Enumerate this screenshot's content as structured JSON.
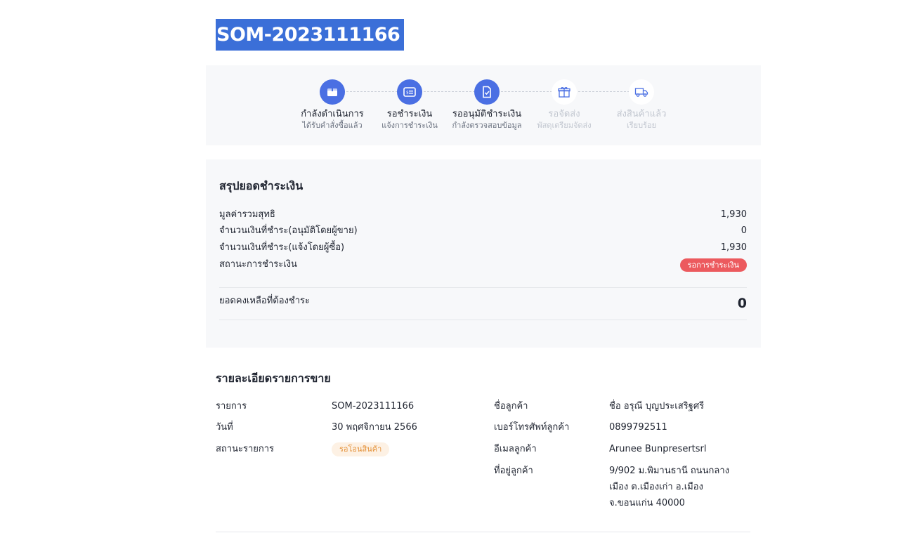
{
  "order": {
    "id": "SOM-2023111166"
  },
  "steps": [
    {
      "title": "กำลังดำเนินการ",
      "subtitle": "ได้รับคำสั่งซื้อแล้ว",
      "icon": "box-icon",
      "state": "done"
    },
    {
      "title": "รอชำระเงิน",
      "subtitle": "แจ้งการชำระเงิน",
      "icon": "payment-card-icon",
      "state": "done"
    },
    {
      "title": "รออนุมัติชำระเงิน",
      "subtitle": "กำลังตรวจสอบข้อมูล",
      "icon": "document-check-icon",
      "state": "current"
    },
    {
      "title": "รอจัดส่ง",
      "subtitle": "พัสดุเตรียมจัดส่ง",
      "icon": "gift-icon",
      "state": "pending"
    },
    {
      "title": "ส่งสินค้าแล้ว",
      "subtitle": "เรียบร้อย",
      "icon": "truck-icon",
      "state": "pending"
    }
  ],
  "summary": {
    "heading": "สรุปยอดชำระเงิน",
    "net_total_label": "มูลค่ารวมสุทธิ",
    "net_total_value": "1,930",
    "paid_approved_label": "จำนวนเงินที่ชำระ(อนุมัติโดยผู้ขาย)",
    "paid_approved_value": "0",
    "paid_reported_label": "จำนวนเงินที่ชำระ(แจ้งโดยผู้ซื้อ)",
    "paid_reported_value": "1,930",
    "payment_status_label": "สถานะการชำระเงิน",
    "payment_status_value": "รอการชำระเงิน",
    "balance_label": "ยอดคงเหลือที่ต้องชำระ",
    "balance_value": "0"
  },
  "details": {
    "heading": "รายละเอียดรายการขาย",
    "item_label": "รายการ",
    "item_value": "SOM-2023111166",
    "date_label": "วันที่",
    "date_value": "30 พฤศจิกายน 2566",
    "status_label": "สถานะรายการ",
    "status_value": "รอโอนสินค้า",
    "customer_name_label": "ชื่อลูกค้า",
    "customer_name_value": "ชื่อ อรุณี บุญประเสริฐศรี",
    "customer_phone_label": "เบอร์โทรศัพท์ลูกค้า",
    "customer_phone_value": "0899792511",
    "customer_email_label": "อีเมลลูกค้า",
    "customer_email_value": "Arunee Bunpresertsrl",
    "customer_address_label": "ที่อยู่ลูกค้า",
    "customer_address_lines": [
      "9/902 ม.พิมานธานี ถนนกลาง",
      "เมือง ต.เมืองเก่า อ.เมือง",
      "จ.ขอนแก่น 40000"
    ]
  },
  "colors": {
    "accent": "#4a6fe3",
    "title_highlight": "#3b6fd8",
    "status_red": "#ec5a5e",
    "status_orange": "#e4923a"
  }
}
